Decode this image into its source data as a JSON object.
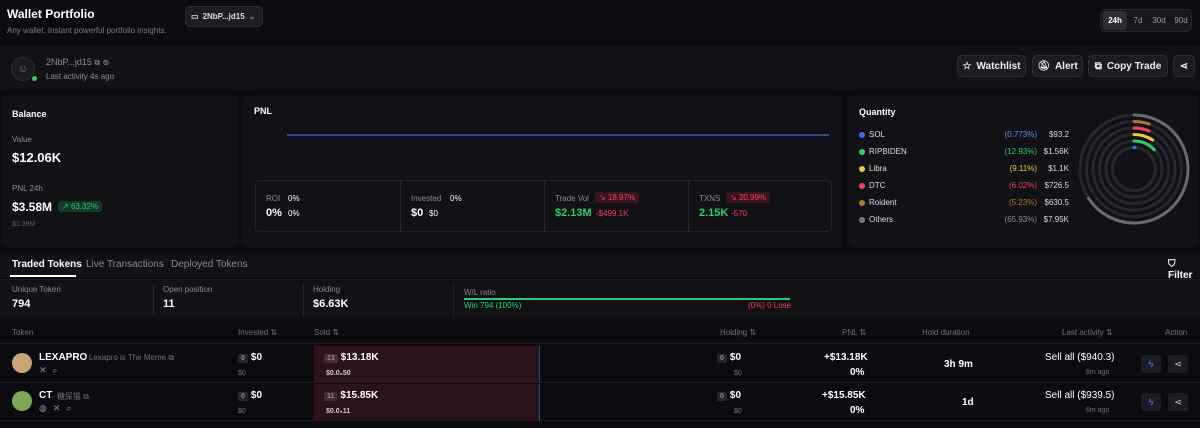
{
  "header": {
    "title": "Wallet Portfolio",
    "subtitle": "Any wallet. Instant powerful portfolio insights.",
    "wallet_select": "2NbP...jd15",
    "ranges": [
      "24h",
      "7d",
      "30d",
      "90d"
    ],
    "active_range": "24h"
  },
  "profile": {
    "address": "2NbP...jd15",
    "last_activity": "Last activity 4s ago",
    "watchlist": "Watchlist",
    "alert": "Alert",
    "copy_trade": "Copy Trade"
  },
  "balance": {
    "title": "Balance",
    "value_label": "Value",
    "value": "$12.06K",
    "pnl_label": "PNL 24h",
    "pnl_value": "$3.58M",
    "pnl_change": "63.32%",
    "pnl_sub": "$1.39M"
  },
  "pnl_card": {
    "title": "PNL",
    "roi_label": "ROI",
    "roi_pct": "0%",
    "roi_value": "0%",
    "roi_sub": "0%",
    "invested_label": "Invested",
    "invested_pct": "0%",
    "invested_value": "$0",
    "invested_sub": "$0",
    "trade_vol_label": "Trade Vol",
    "trade_vol_change": "18.97%",
    "trade_vol_value": "$2.13M",
    "trade_vol_sub": "-$499.1K",
    "txns_label": "TXNS",
    "txns_change": "20.99%",
    "txns_value": "2.15K",
    "txns_sub": "-570"
  },
  "quantity": {
    "title": "Quantity",
    "items": [
      {
        "name": "SOL",
        "pct": "(0.773%)",
        "value": "$93.2",
        "color": "#3b6cf6",
        "pct_color": "#5b8cff"
      },
      {
        "name": "RIPBIDEN",
        "pct": "(12.93%)",
        "value": "$1.56K",
        "color": "#2ecc71",
        "pct_color": "#2ecc71"
      },
      {
        "name": "Libra",
        "pct": "(9.11%)",
        "value": "$1.1K",
        "color": "#f5c542",
        "pct_color": "#f5c542"
      },
      {
        "name": "DTC",
        "pct": "(6.02%)",
        "value": "$726.5",
        "color": "#f0425a",
        "pct_color": "#f0425a"
      },
      {
        "name": "Roident",
        "pct": "(5.23%)",
        "value": "$630.5",
        "color": "#a87a2e",
        "pct_color": "#a87a2e"
      },
      {
        "name": "Others",
        "pct": "(65.93%)",
        "value": "$7.95K",
        "color": "#777780",
        "pct_color": "#8a8a94"
      }
    ]
  },
  "tabs": {
    "traded": "Traded Tokens",
    "live": "Live Transactions",
    "deployed": "Deployed Tokens",
    "filter": "Filter"
  },
  "summary": {
    "unique_label": "Unique Token",
    "unique_value": "794",
    "open_label": "Open position",
    "open_value": "11",
    "holding_label": "Holding",
    "holding_value": "$6.63K",
    "wl_label": "W/L ratio",
    "win_text": "Win 794 (100%)",
    "lose_text": "(0%) 0 Lose",
    "win_ratio": 1.0
  },
  "table": {
    "headers": {
      "token": "Token",
      "invested": "Invested",
      "sold": "Sold",
      "holding": "Holding",
      "pnl": "PNL",
      "hold_duration": "Hold duration",
      "last_activity": "Last activity",
      "action": "Action"
    },
    "rows": [
      {
        "name": "LEXAPRO",
        "desc": "- Lexapro is The Meme",
        "invested_badge": "0",
        "invested": "$0",
        "invested_sub": "$0",
        "sold_badge": "13",
        "sold": "$13.18K",
        "sold_sub": "$0.0₅50",
        "holding_badge": "0",
        "holding": "$0",
        "holding_sub": "$0",
        "pnl": "+$13.18K",
        "pnl_pct": "0%",
        "hold_duration": "3h 9m",
        "last_activity": "Sell all ($940.3)",
        "last_ago": "6m ago"
      },
      {
        "name": "CT",
        "desc": "- 糖尿猫",
        "invested_badge": "0",
        "invested": "$0",
        "invested_sub": "$0",
        "sold_badge": "11",
        "sold": "$15.85K",
        "sold_sub": "$0.0₅11",
        "holding_badge": "0",
        "holding": "$0",
        "holding_sub": "$0",
        "pnl": "+$15.85K",
        "pnl_pct": "0%",
        "hold_duration": "1d",
        "last_activity": "Sell all ($939.5)",
        "last_ago": "6m ago"
      }
    ]
  }
}
